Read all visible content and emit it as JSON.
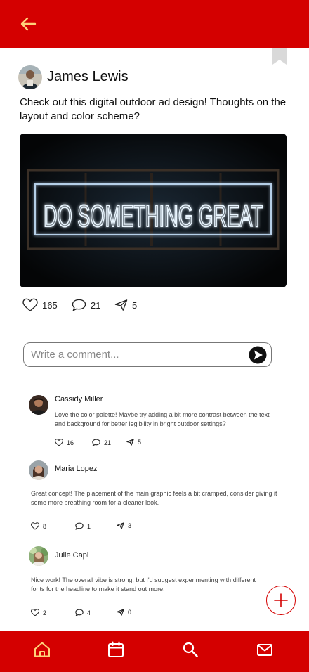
{
  "colors": {
    "brand": "#d40000",
    "accent": "#ffd27a",
    "white": "#ffffff"
  },
  "topbar": {
    "back_icon": "arrow-left-icon"
  },
  "post": {
    "author": "James Lewis",
    "text": "Check out this digital outdoor ad design! Thoughts on the layout and color scheme?",
    "image_sign_text": "DO SOMETHING GREAT",
    "likes": "165",
    "comments": "21",
    "shares": "5"
  },
  "comment_box": {
    "placeholder": "Write a comment..."
  },
  "comments": [
    {
      "name": "Cassidy Miller",
      "text": "Love the color palette! Maybe try adding a bit more contrast between the text and background for better legibility in bright outdoor settings?",
      "likes": "16",
      "replies": "21",
      "shares": "5"
    },
    {
      "name": "Maria Lopez",
      "text": "Great concept! The placement of the main graphic feels a bit cramped, consider giving it some more breathing room for a cleaner look.",
      "likes": "8",
      "replies": "1",
      "shares": "3"
    },
    {
      "name": "Julie Capi",
      "text": "Nice work! The overall vibe is strong, but I'd suggest experimenting with different fonts for the headline to make it stand out more.",
      "likes": "2",
      "replies": "4",
      "shares": "0"
    }
  ],
  "bottom_nav": [
    {
      "icon": "home-icon",
      "active": true
    },
    {
      "icon": "calendar-icon",
      "active": false
    },
    {
      "icon": "search-icon",
      "active": false
    },
    {
      "icon": "mail-icon",
      "active": false
    }
  ]
}
